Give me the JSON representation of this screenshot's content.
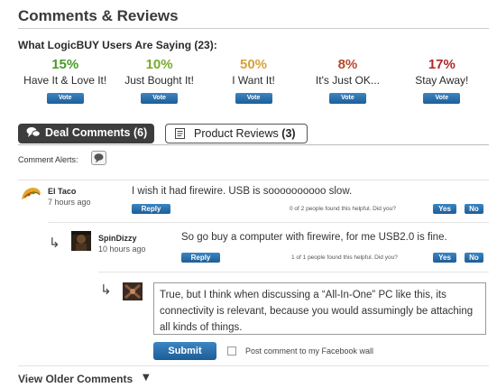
{
  "section_title": "Comments & Reviews",
  "users_saying": "What LogicBUY Users Are Saying (23):",
  "vote_options": [
    {
      "percent": "15%",
      "label": "Have It & Love It!",
      "button": "Vote",
      "color": "#4a9a2a"
    },
    {
      "percent": "10%",
      "label": "Just Bought It!",
      "button": "Vote",
      "color": "#7aa82e"
    },
    {
      "percent": "50%",
      "label": "I Want It!",
      "button": "Vote",
      "color": "#d9a23a"
    },
    {
      "percent": "8%",
      "label": "It's Just OK...",
      "button": "Vote",
      "color": "#b8492e"
    },
    {
      "percent": "17%",
      "label": "Stay Away!",
      "button": "Vote",
      "color": "#b02a2a"
    }
  ],
  "tabs": {
    "deal_label": "Deal Comments (6)",
    "product_label": "Product Reviews",
    "product_count": "(3)"
  },
  "comment_alerts_label": "Comment Alerts:",
  "comments": [
    {
      "author": "El Taco",
      "time": "7 hours ago",
      "text": "I wish it had firewire. USB is soooooooooo slow.",
      "reply": "Reply",
      "helpful": "0 of 2 people found this helpful. Did you?",
      "yes": "Yes",
      "no": "No"
    },
    {
      "author": "SpinDizzy",
      "time": "10 hours ago",
      "text": "So go buy a computer with firewire, for me USB2.0 is fine.",
      "reply": "Reply",
      "helpful": "1 of 1 people found this helpful. Did you?",
      "yes": "Yes",
      "no": "No"
    }
  ],
  "reply_box": {
    "value": "True, but I think when discussing a “All-In-One” PC like this, its connectivity is relevant, because you would assumingly be attaching all kinds of things.",
    "submit": "Submit",
    "facebook_label": "Post comment to my Facebook wall"
  },
  "view_older": "View Older Comments",
  "colors": {
    "button_blue": "#2a72b1",
    "tab_dark": "#3d3d3d"
  }
}
